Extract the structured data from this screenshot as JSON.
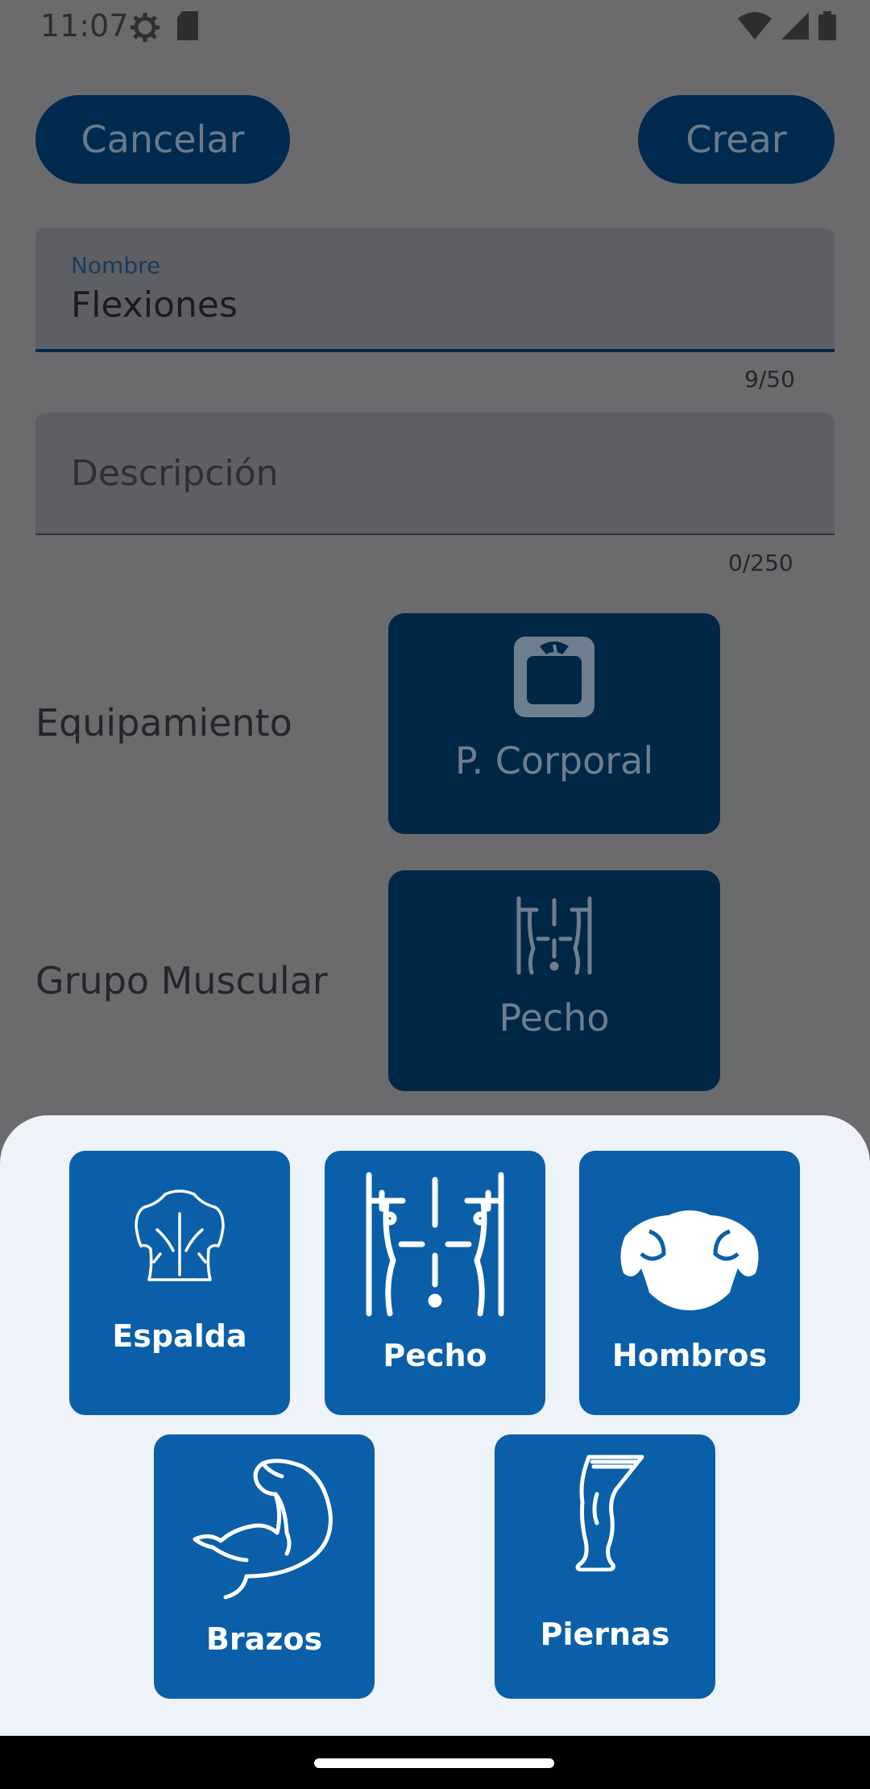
{
  "status_bar": {
    "time": "11:07",
    "left_icons": [
      "settings-icon",
      "sd-card-icon"
    ],
    "right_icons": [
      "wifi-icon",
      "signal-icon",
      "battery-icon"
    ]
  },
  "header": {
    "cancel_label": "Cancelar",
    "create_label": "Crear"
  },
  "form": {
    "name": {
      "label": "Nombre",
      "value": "Flexiones",
      "counter": "9/50"
    },
    "description": {
      "placeholder": "Descripción",
      "counter": "0/250"
    },
    "equipment": {
      "label": "Equipamiento",
      "selected": "P. Corporal",
      "icon": "scale-icon"
    },
    "muscle_group": {
      "label": "Grupo Muscular",
      "selected": "Pecho",
      "icon": "chest-icon"
    }
  },
  "muscle_sheet": {
    "options": [
      {
        "label": "Espalda",
        "icon": "back-icon"
      },
      {
        "label": "Pecho",
        "icon": "chest-icon"
      },
      {
        "label": "Hombros",
        "icon": "shoulders-icon"
      },
      {
        "label": "Brazos",
        "icon": "arm-icon"
      },
      {
        "label": "Piernas",
        "icon": "leg-icon"
      }
    ]
  },
  "colors": {
    "primary": "#0a5fa8",
    "primary_dark": "#002a4f",
    "sheet_background": "#eef2f9",
    "scrim": "#6b6b6d"
  }
}
